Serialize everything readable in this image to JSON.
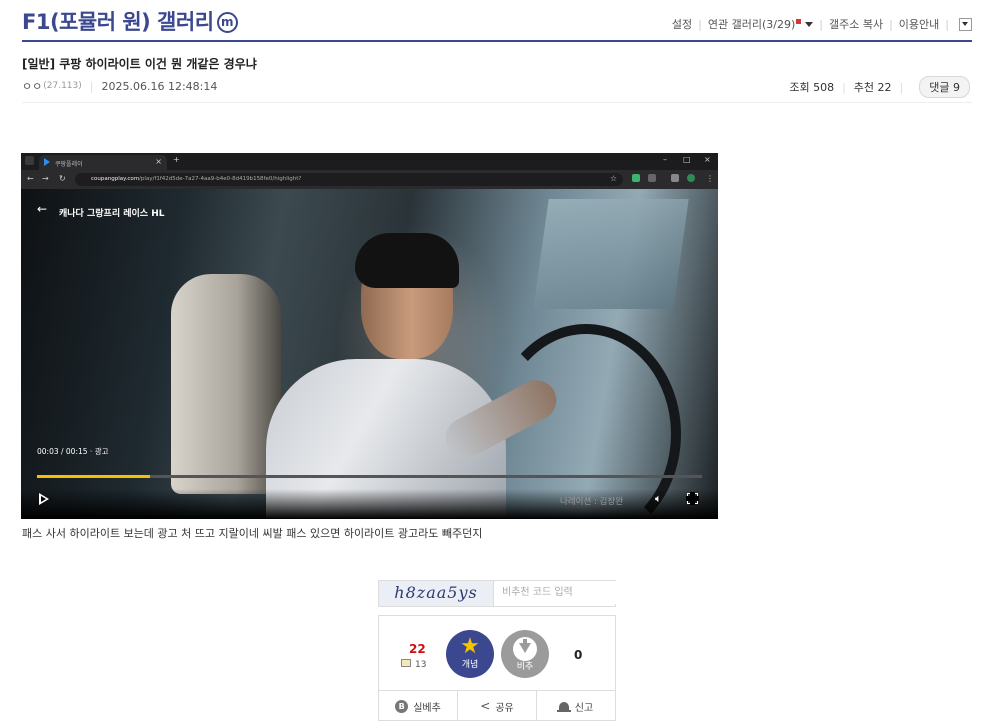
{
  "gallery": {
    "title": "F1(포뮬러 원) 갤러리",
    "badge": "m"
  },
  "top_links": {
    "settings": "설정",
    "related": "연관 갤러리(3/29)",
    "copy_addr": "갤주소 복사",
    "guide": "이용안내"
  },
  "post": {
    "title": "[일반] 쿠팡 하이라이트 이건 뭔 개같은 경우냐",
    "author": "ㅇㅇ",
    "ip": "(27.113)",
    "datetime": "2025.06.16 12:48:14",
    "views": "조회 508",
    "recommends": "추천 22",
    "replies": "댓글 9",
    "body": "패스 사서 하이라이트 보는데 광고 처 뜨고 지랄이네 씨발 패스 있으면 하이라이트 광고라도 빼주던지"
  },
  "screenshot": {
    "tab_title": "쿠팡플레이",
    "url_domain": "coupangplay.com",
    "url_path": "/play/f1f42d5de-7a27-4aa9-b4e0-8d419b158fe0/highlight?",
    "video_title": "캐나다 그랑프리 레이스 HL",
    "time": "00:03 / 00:15",
    "ad_label": "광고",
    "narration": "나레이션 : 김창완",
    "progress": 0.17
  },
  "recommend": {
    "captcha_text": "h8zaa5ys",
    "captcha_placeholder": "비추천 코드 입력",
    "up_count": "22",
    "fixed_count": "13",
    "up_label": "개념",
    "down_label": "비추",
    "down_count": "0",
    "real_up": "실베추",
    "share": "공유",
    "report": "신고"
  },
  "colors": {
    "brand": "#3b4890",
    "up_count": "#cc1111",
    "progress": "#f5c000"
  }
}
